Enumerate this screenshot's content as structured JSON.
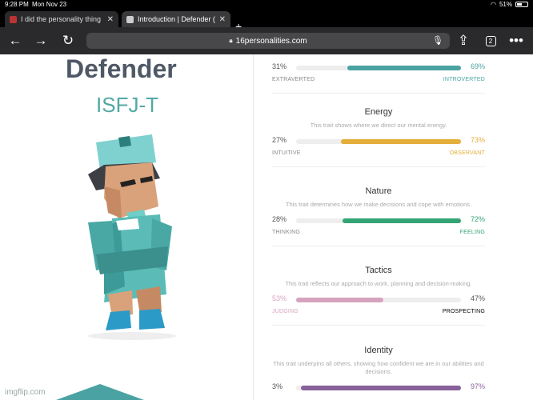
{
  "status": {
    "time": "9:28 PM",
    "date": "Mon Nov 23",
    "battery": "51%"
  },
  "tabs": [
    {
      "title": "I did the personality thing",
      "favicon_color": "#b33"
    },
    {
      "title": "Introduction | Defender (ISFJ",
      "favicon_color": "#ccc"
    }
  ],
  "address": {
    "url": "16personalities.com"
  },
  "toolbar": {
    "tab_count": "2"
  },
  "profile": {
    "type_name": "Defender",
    "type_code": "ISFJ-T"
  },
  "traits": [
    {
      "name": "",
      "description": "",
      "left_pct": "31%",
      "right_pct": "69%",
      "left_label": "EXTRAVERTED",
      "right_label": "INTROVERTED",
      "value_side": "right",
      "value": 69,
      "color": "#4aa3a2"
    },
    {
      "name": "Energy",
      "description": "This trait shows where we direct our mental energy.",
      "left_pct": "27%",
      "right_pct": "73%",
      "left_label": "INTUITIVE",
      "right_label": "OBSERVANT",
      "value_side": "right",
      "value": 73,
      "color": "#e4ae3a"
    },
    {
      "name": "Nature",
      "description": "This trait determines how we make decisions and cope with emotions.",
      "left_pct": "28%",
      "right_pct": "72%",
      "left_label": "THINKING",
      "right_label": "FEELING",
      "value_side": "right",
      "value": 72,
      "color": "#33a474"
    },
    {
      "name": "Tactics",
      "description": "This trait reflects our approach to work, planning and decision-making.",
      "left_pct": "53%",
      "right_pct": "47%",
      "left_label": "JUDGING",
      "right_label": "PROSPECTING",
      "value_side": "left",
      "value": 53,
      "color": "#d6a3be"
    },
    {
      "name": "Identity",
      "description": "This trait underpins all others, showing how confident we are in our abilities and decisions.",
      "left_pct": "3%",
      "right_pct": "97%",
      "left_label": "",
      "right_label": "",
      "value_side": "right",
      "value": 97,
      "color": "#88619a"
    }
  ],
  "watermark": "imgflip.com"
}
